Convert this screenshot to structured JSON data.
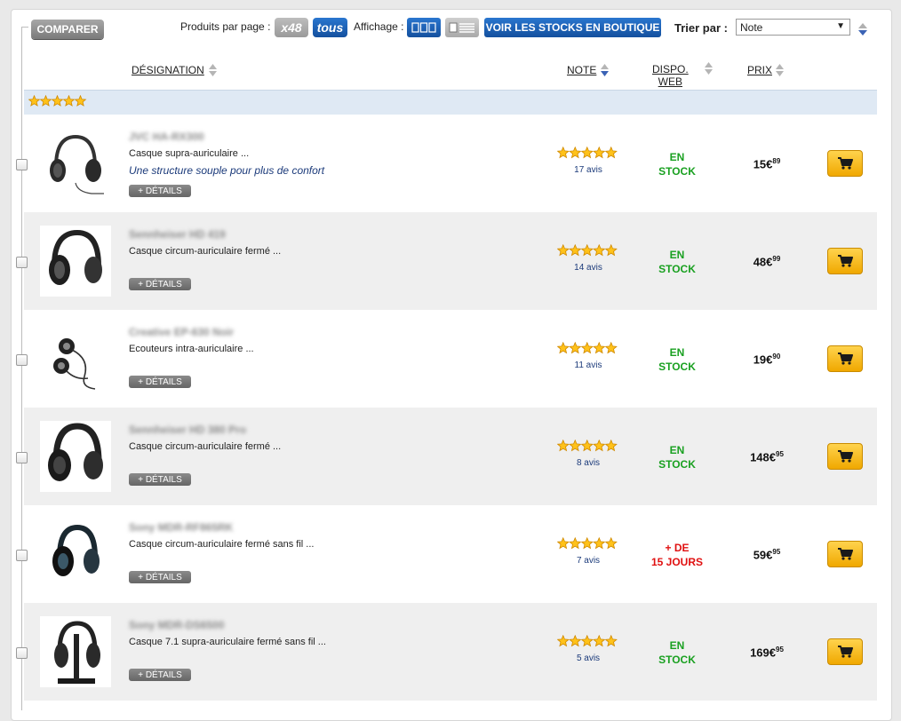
{
  "toolbar": {
    "compare_label": "COMPARER",
    "per_page_label": "Produits par page :",
    "per_page_x48": "x48",
    "per_page_all": "tous",
    "display_label": "Affichage :",
    "stock_button": "VOIR LES STOCKS EN BOUTIQUE",
    "sort_label": "Trier par :",
    "sort_value": "Note",
    "sort_arrow": "▼"
  },
  "columns": {
    "designation": "DÉSIGNATION",
    "note": "NOTE",
    "dispo_line1": "DISPO.",
    "dispo_line2": "WEB",
    "prix": "PRIX"
  },
  "group": {
    "rating": 5
  },
  "products": [
    {
      "name": "JVC HA-RX300",
      "desc": "Casque supra-auriculaire ...",
      "tagline": "Une structure souple pour plus de confort",
      "details": "+ DÉTAILS",
      "rating": 5,
      "reviews": "17 avis",
      "dispo1": "EN",
      "dispo2": "STOCK",
      "dispo_color": "#19a020",
      "price_int": "15€",
      "price_dec": "89"
    },
    {
      "name": "Sennheiser HD 419",
      "desc": "Casque circum-auriculaire fermé ...",
      "tagline": "",
      "details": "+ DÉTAILS",
      "rating": 5,
      "reviews": "14 avis",
      "dispo1": "EN",
      "dispo2": "STOCK",
      "dispo_color": "#19a020",
      "price_int": "48€",
      "price_dec": "99"
    },
    {
      "name": "Creative EP-630 Noir",
      "desc": "Ecouteurs intra-auriculaire ...",
      "tagline": "",
      "details": "+ DÉTAILS",
      "rating": 5,
      "reviews": "11 avis",
      "dispo1": "EN",
      "dispo2": "STOCK",
      "dispo_color": "#19a020",
      "price_int": "19€",
      "price_dec": "90"
    },
    {
      "name": "Sennheiser HD 380 Pro",
      "desc": "Casque circum-auriculaire fermé ...",
      "tagline": "",
      "details": "+ DÉTAILS",
      "rating": 5,
      "reviews": "8 avis",
      "dispo1": "EN",
      "dispo2": "STOCK",
      "dispo_color": "#19a020",
      "price_int": "148€",
      "price_dec": "95"
    },
    {
      "name": "Sony MDR-RF865RK",
      "desc": "Casque circum-auriculaire fermé sans fil ...",
      "tagline": "",
      "details": "+ DÉTAILS",
      "rating": 5,
      "reviews": "7 avis",
      "dispo1": "+ DE",
      "dispo2": "15 JOURS",
      "dispo_color": "#e01010",
      "price_int": "59€",
      "price_dec": "95"
    },
    {
      "name": "Sony MDR-DS6500",
      "desc": "Casque 7.1 supra-auriculaire fermé sans fil ...",
      "tagline": "",
      "details": "+ DÉTAILS",
      "rating": 5,
      "reviews": "5 avis",
      "dispo1": "EN",
      "dispo2": "STOCK",
      "dispo_color": "#19a020",
      "price_int": "169€",
      "price_dec": "95"
    }
  ],
  "icons": {
    "cart": "cart-icon",
    "star": "star-icon",
    "sort": "sort-arrows-icon"
  }
}
